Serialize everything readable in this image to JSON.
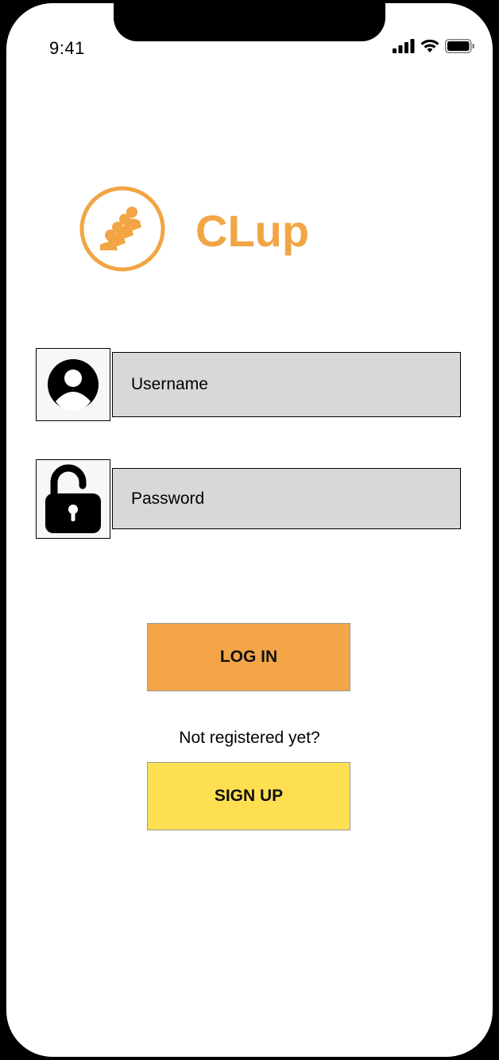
{
  "status_bar": {
    "time": "9:41"
  },
  "brand": {
    "name": "CLup",
    "accent_color": "#f1a544"
  },
  "form": {
    "username_placeholder": "Username",
    "password_placeholder": "Password"
  },
  "actions": {
    "login_label": "LOG IN",
    "login_color": "#f4a547",
    "signup_prompt": "Not registered yet?",
    "signup_label": "SIGN UP",
    "signup_color": "#ffdf52"
  },
  "icons": {
    "user": "user-icon",
    "password": "unlocked-padlock-icon",
    "logo": "people-queue-logo"
  }
}
